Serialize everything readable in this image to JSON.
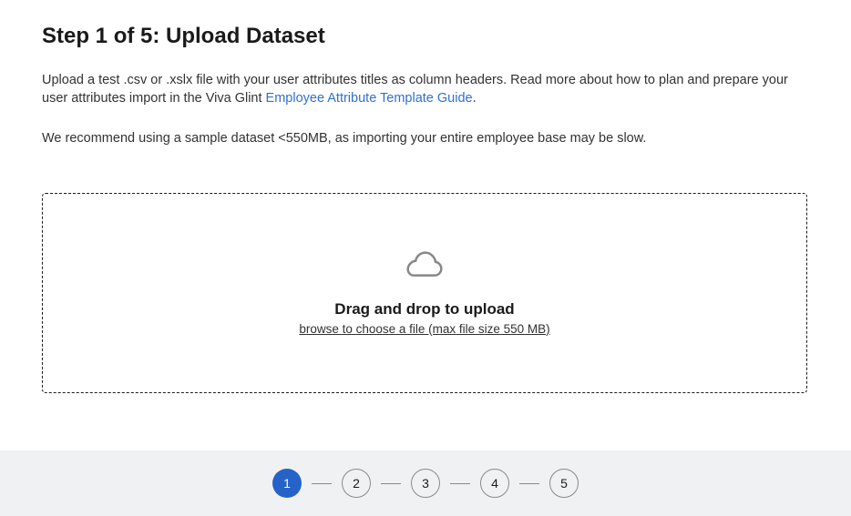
{
  "header": {
    "title": "Step 1 of 5: Upload Dataset"
  },
  "body": {
    "description_before_link": "Upload a test .csv or .xslx file with your user attributes titles as column headers. Read more about how to plan and prepare your user attributes import in the Viva Glint ",
    "description_link_text": "Employee Attribute Template Guide",
    "description_after_link": ".",
    "recommendation": "We recommend using a sample dataset <550MB, as importing your entire employee base may be slow."
  },
  "dropzone": {
    "title": "Drag and drop to upload",
    "subtitle": "browse to choose a file (max file size 550 MB)"
  },
  "stepper": {
    "steps": [
      "1",
      "2",
      "3",
      "4",
      "5"
    ],
    "active_index": 0
  }
}
